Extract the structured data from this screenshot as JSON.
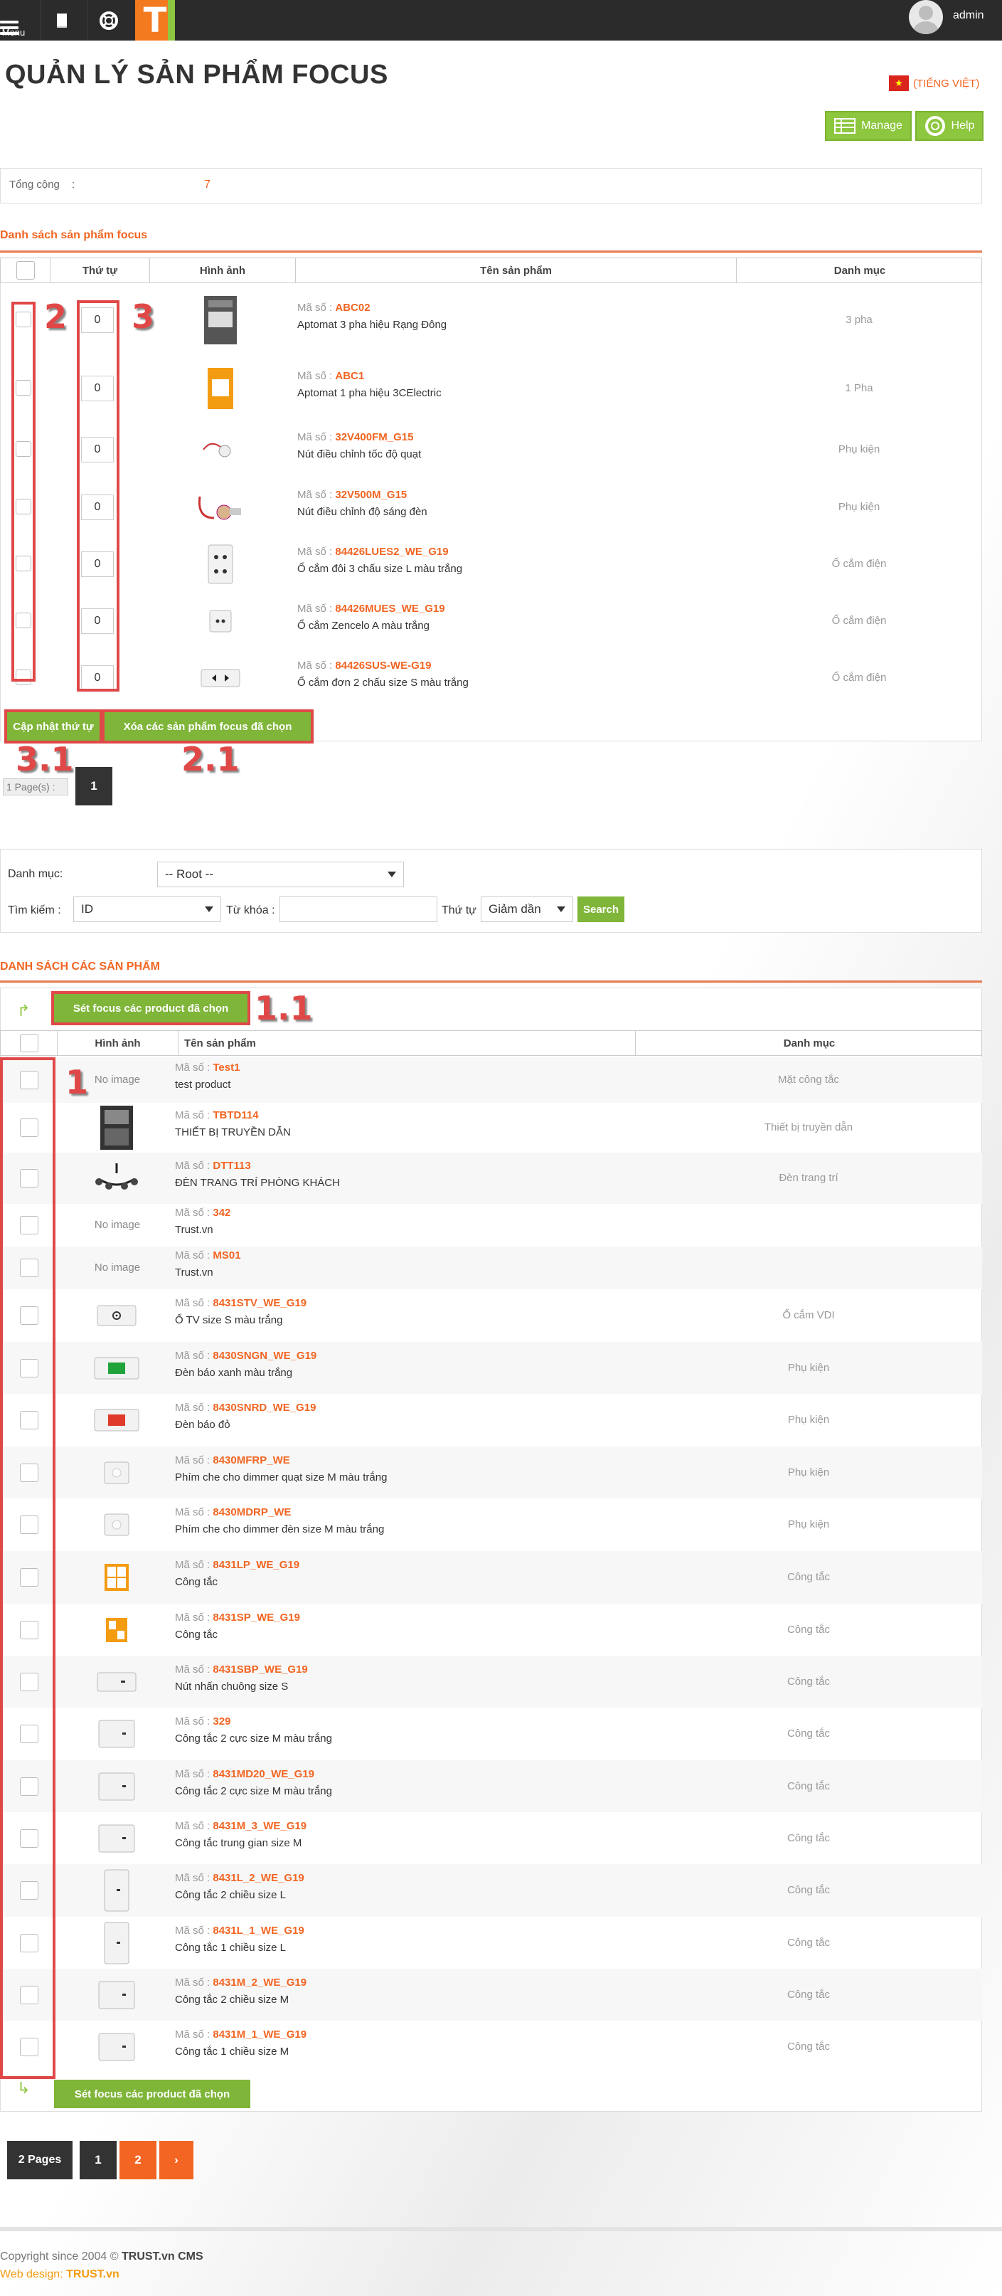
{
  "topbar": {
    "menu_label": "Menu",
    "username": "admin",
    "logo_letter": "T"
  },
  "header": {
    "title": "QUẢN LÝ SẢN PHẨM FOCUS",
    "language": "(TIẾNG VIỆT)",
    "manage_label": "Manage",
    "help_label": "Help"
  },
  "summary": {
    "label": "Tổng cộng",
    "value": "7"
  },
  "focus_section": {
    "title": "Danh sách sản phẩm focus",
    "columns": [
      "Thứ tự",
      "Hình ảnh",
      "Tên sản phẩm",
      "Danh mục"
    ],
    "code_prefix": "Mã số :",
    "rows": [
      {
        "order": "0",
        "code": "ABC02",
        "name": "Aptomat 3 pha hiệu Rạng Đông",
        "category": "3 pha",
        "icon": "breaker-3-pole-icon"
      },
      {
        "order": "0",
        "code": "ABC1",
        "name": "Aptomat 1 pha hiệu 3CElectric",
        "category": "1 Pha",
        "icon": "breaker-1-pole-icon"
      },
      {
        "order": "0",
        "code": "32V400FM_G15",
        "name": "Nút điều chỉnh tốc độ quạt",
        "category": "Phụ kiện",
        "icon": "fan-knob-icon"
      },
      {
        "order": "0",
        "code": "32V500M_G15",
        "name": "Nút điều chỉnh độ sáng đèn",
        "category": "Phụ kiện",
        "icon": "dimmer-knob-icon"
      },
      {
        "order": "0",
        "code": "84426LUES2_WE_G19",
        "name": "Ổ cắm đôi 3 chấu size L màu trắng",
        "category": "Ổ cắm điện",
        "icon": "double-socket-icon"
      },
      {
        "order": "0",
        "code": "84426MUES_WE_G19",
        "name": "Ổ cắm Zencelo A màu trắng",
        "category": "Ổ cắm điện",
        "icon": "socket-icon"
      },
      {
        "order": "0",
        "code": "84426SUS-WE-G19",
        "name": "Ổ cắm đơn 2 chấu size S màu trắng",
        "category": "Ổ cắm điện",
        "icon": "single-socket-icon"
      }
    ],
    "update_button": "Cập nhật thứ tự",
    "delete_button": "Xóa các sản phẩm focus đã chọn",
    "pages_label": "1 Page(s) :",
    "current_page": "1"
  },
  "annotations": {
    "a1": "1",
    "a11": "1.1",
    "a2": "2",
    "a21": "2.1",
    "a3": "3",
    "a31": "3.1"
  },
  "filter": {
    "category_label": "Danh mục:",
    "category_value": "-- Root --",
    "search_label": "Tìm kiếm :",
    "search_field_value": "ID",
    "keyword_label": "Từ khóa :",
    "keyword_value": "",
    "order_label": "Thứ tự",
    "order_value": "Giảm dần",
    "search_button": "Search"
  },
  "products_section": {
    "title": "DANH SÁCH CÁC SẢN PHẨM",
    "set_focus_button": "Sét focus các product đã chọn",
    "columns": [
      "Hình ảnh",
      "Tên sản phẩm",
      "Danh mục"
    ],
    "no_image": "No image",
    "rows": [
      {
        "code": "Test1",
        "name": "test product",
        "category": "Mặt công tắc",
        "image": "none"
      },
      {
        "code": "TBTD114",
        "name": "THIẾT BỊ TRUYỀN DẪN",
        "category": "Thiết bị truyền dẫn",
        "image": "cabinet-icon"
      },
      {
        "code": "DTT113",
        "name": "ĐÈN TRANG TRÍ PHÒNG KHÁCH",
        "category": "Đèn trang trí",
        "image": "chandelier-icon"
      },
      {
        "code": "342",
        "name": "Trust.vn",
        "category": "",
        "image": "none"
      },
      {
        "code": "MS01",
        "name": "Trust.vn",
        "category": "",
        "image": "none"
      },
      {
        "code": "8431STV_WE_G19",
        "name": "Ổ TV size S màu trắng",
        "category": "Ổ cắm VDI",
        "image": "tv-socket-icon"
      },
      {
        "code": "8430SNGN_WE_G19",
        "name": "Đèn báo xanh màu trắng",
        "category": "Phụ kiện",
        "image": "green-indicator-icon"
      },
      {
        "code": "8430SNRD_WE_G19",
        "name": "Đèn báo đỏ",
        "category": "Phụ kiện",
        "image": "red-indicator-icon"
      },
      {
        "code": "8430MFRP_WE",
        "name": "Phím che cho dimmer quạt size M màu trắng",
        "category": "Phụ kiện",
        "image": "cover-plate-icon"
      },
      {
        "code": "8430MDRP_WE",
        "name": "Phím che cho dimmer đèn size M màu trắng",
        "category": "Phụ kiện",
        "image": "cover-plate-icon"
      },
      {
        "code": "8431LP_WE_G19",
        "name": "Công tắc",
        "category": "Công tắc",
        "image": "orange-switch-icon"
      },
      {
        "code": "8431SP_WE_G19",
        "name": "Công tắc",
        "category": "Công tắc",
        "image": "orange-switch-small-icon"
      },
      {
        "code": "8431SBP_WE_G19",
        "name": "Nút nhấn chuông size S",
        "category": "Công tắc",
        "image": "bell-button-icon"
      },
      {
        "code": "329",
        "name": "Công tắc 2 cực size M màu trắng",
        "category": "Công tắc",
        "image": "switch-icon"
      },
      {
        "code": "8431MD20_WE_G19",
        "name": "Công tắc 2 cực size M màu trắng",
        "category": "Công tắc",
        "image": "switch-icon"
      },
      {
        "code": "8431M_3_WE_G19",
        "name": "Công tắc trung gian size M",
        "category": "Công tắc",
        "image": "switch-icon"
      },
      {
        "code": "8431L_2_WE_G19",
        "name": "Công tắc 2 chiều size L",
        "category": "Công tắc",
        "image": "tall-switch-icon"
      },
      {
        "code": "8431L_1_WE_G19",
        "name": "Công tắc 1 chiều size L",
        "category": "Công tắc",
        "image": "tall-switch-icon"
      },
      {
        "code": "8431M_2_WE_G19",
        "name": "Công tắc 2 chiều size M",
        "category": "Công tắc",
        "image": "switch-icon"
      },
      {
        "code": "8431M_1_WE_G19",
        "name": "Công tắc 1 chiều size M",
        "category": "Công tắc",
        "image": "switch-icon"
      }
    ],
    "pagination": {
      "label": "2 Pages",
      "pages": [
        "1",
        "2"
      ],
      "next": "›"
    }
  },
  "footer": {
    "copyright_prefix": "Copyright since 2004 ©",
    "copyright_brand": "TRUST.vn CMS",
    "design_prefix": "Web design:",
    "design_brand": "TRUST.vn"
  },
  "colors": {
    "accent": "#f26522",
    "green": "#8dc63f",
    "dark": "#2b2b2b",
    "annotation_red": "#e04848"
  }
}
